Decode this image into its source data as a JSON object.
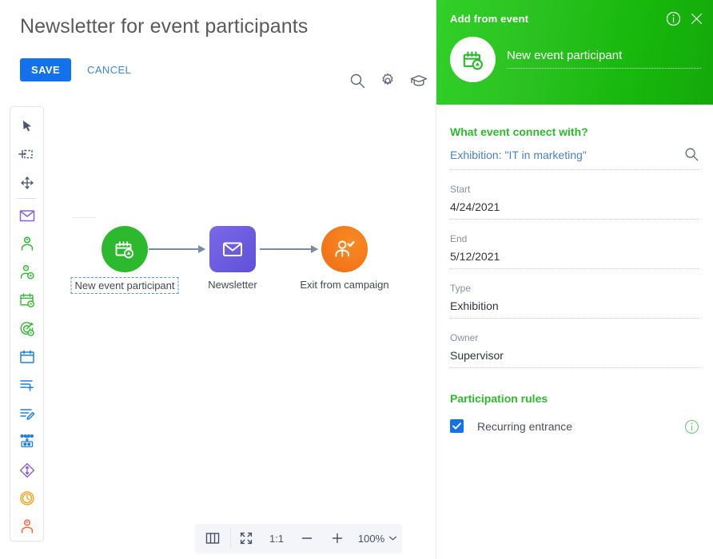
{
  "canvas": {
    "title": "Newsletter for event participants",
    "save_label": "SAVE",
    "cancel_label": "CANCEL",
    "tools": [
      {
        "name": "search-icon",
        "label": "Search"
      },
      {
        "name": "gear-icon",
        "label": "Settings"
      },
      {
        "name": "graduation-cap-icon",
        "label": "Learning"
      }
    ],
    "toolbar_items": [
      {
        "name": "cursor-select-icon",
        "label": "Select"
      },
      {
        "name": "add-area-icon",
        "label": "Add area"
      },
      {
        "name": "move-icon",
        "label": "Move"
      },
      {
        "name": "email-icon",
        "label": "Email"
      },
      {
        "name": "audience-icon",
        "label": "Audience"
      },
      {
        "name": "add-audience-icon",
        "label": "Add audience"
      },
      {
        "name": "event-add-icon",
        "label": "Event"
      },
      {
        "name": "campaign-target-icon",
        "label": "Campaign goal"
      },
      {
        "name": "calendar-icon",
        "label": "Calendar"
      },
      {
        "name": "add-to-list-icon",
        "label": "Add to list"
      },
      {
        "name": "edit-list-icon",
        "label": "Edit data"
      },
      {
        "name": "switch-case-icon",
        "label": "Condition"
      },
      {
        "name": "split-flow-icon",
        "label": "Split flow"
      },
      {
        "name": "timer-icon",
        "label": "Timer"
      },
      {
        "name": "exit-person-icon",
        "label": "Exit"
      }
    ]
  },
  "flow": {
    "nodes": [
      {
        "id": "start",
        "label": "New event participant",
        "icon": "event-participant-icon",
        "color": "#2db92d",
        "shape": "circle",
        "selected": true
      },
      {
        "id": "email",
        "label": "Newsletter",
        "icon": "envelope-icon",
        "color": "#6f5fe0",
        "shape": "square",
        "selected": false
      },
      {
        "id": "exit",
        "label": "Exit from campaign",
        "icon": "exit-check-icon",
        "color": "#f47d1b",
        "shape": "circle",
        "selected": false
      }
    ]
  },
  "zoombar": {
    "columns_label": "columns-view-icon",
    "fit_label": "fit-to-screen-icon",
    "ratio_label": "1:1",
    "minus_label": "−",
    "plus_label": "+",
    "zoom_level": "100%"
  },
  "panel": {
    "header_title": "Add from event",
    "entity_name": "New event participant",
    "info_icon": "info-icon",
    "close_icon": "close-icon",
    "section_event": "What event connect with?",
    "lookup_value": "Exhibition: \"IT in marketing\"",
    "lookup_search_icon": "search-icon",
    "fields": [
      {
        "label": "Start",
        "value": "4/24/2021"
      },
      {
        "label": "End",
        "value": "5/12/2021"
      },
      {
        "label": "Type",
        "value": "Exhibition"
      },
      {
        "label": "Owner",
        "value": "Supervisor"
      }
    ],
    "section_rules": "Participation rules",
    "rule_label": "Recurring entrance",
    "rule_checked": true,
    "rule_info_icon": "info-icon"
  },
  "colors": {
    "accent_blue": "#1471ec",
    "green": "#2db92d",
    "purple": "#6f5fe0",
    "orange": "#f47d1b",
    "connector": "#7b8ba6"
  }
}
